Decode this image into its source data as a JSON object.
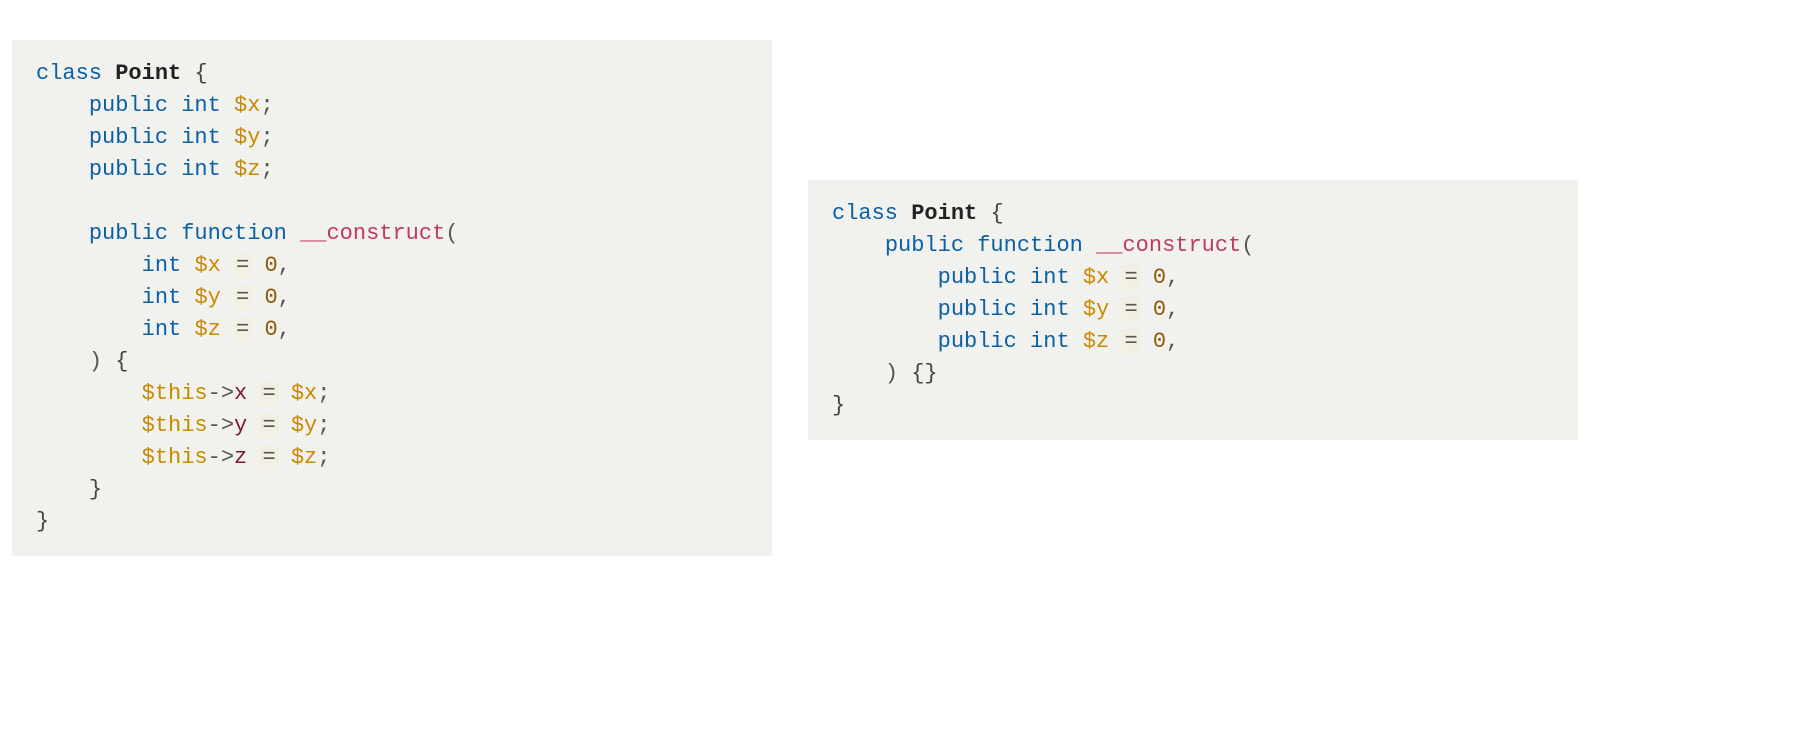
{
  "kw_class": "class",
  "kw_public": "public",
  "kw_function": "function",
  "kw_int": "int",
  "class_name": "Point",
  "fn_name": "__construct",
  "var_x": "$x",
  "var_y": "$y",
  "var_z": "$z",
  "var_this": "$this",
  "prop_x": "x",
  "prop_y": "y",
  "prop_z": "z",
  "num_zero": "0",
  "brace_open": "{",
  "brace_close": "}",
  "paren_open": "(",
  "paren_close": ")",
  "semi": ";",
  "comma": ",",
  "eq": "=",
  "arrow": "->",
  "empty_braces": "{}"
}
